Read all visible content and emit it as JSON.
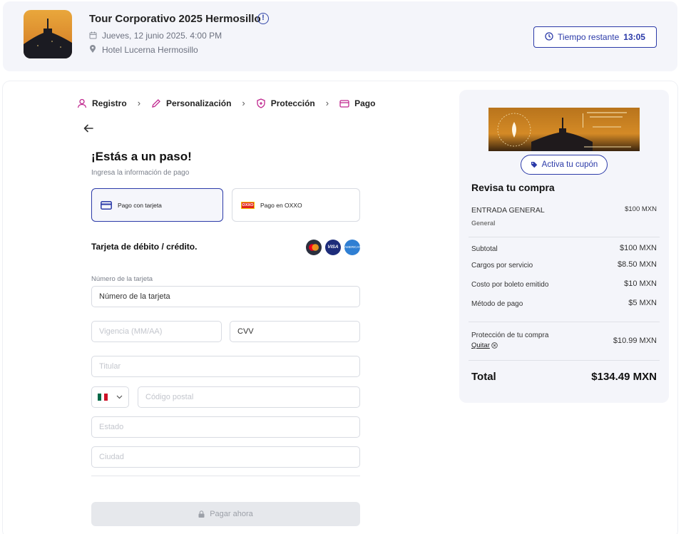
{
  "event": {
    "title": "Tour Corporativo 2025 Hermosillo",
    "date": "Jueves, 12 junio 2025. 4:00 PM",
    "venue": "Hotel Lucerna Hermosillo",
    "timer_label": "Tiempo restante",
    "timer_value": "13:05"
  },
  "steps": [
    {
      "label": "Registro",
      "icon": "user-icon"
    },
    {
      "label": "Personalización",
      "icon": "pencil-icon"
    },
    {
      "label": "Protección",
      "icon": "shield-plus-icon"
    },
    {
      "label": "Pago",
      "icon": "credit-card-icon"
    }
  ],
  "payment": {
    "heading": "¡Estás a un paso!",
    "subheading": "Ingresa la información de pago",
    "options": {
      "card": "Pago con tarjeta",
      "oxxo": "Pago en OXXO",
      "oxxo_logo": "OXXO"
    },
    "card_section_title": "Tarjeta de débito / crédito.",
    "brands": {
      "visa": "VISA",
      "amex": "AMERICAN EXPRESS"
    },
    "fields": {
      "number_label": "Número de la tarjeta",
      "number_value": "Número de la tarjeta",
      "expiry_placeholder": "Vigencia (MM/AA)",
      "cvv_value": "CVV",
      "holder_placeholder": "Titular",
      "zip_placeholder": "Código postal",
      "state_placeholder": "Estado",
      "city_placeholder": "Ciudad"
    },
    "pay_button": "Pagar ahora"
  },
  "summary": {
    "coupon_button": "Activa tu cupón",
    "title": "Revisa tu compra",
    "ticket_name": "ENTRADA GENERAL",
    "ticket_type": "General",
    "ticket_price": "$100 MXN",
    "rows": [
      {
        "label": "Subtotal",
        "value": "$100 MXN"
      },
      {
        "label": "Cargos por servicio",
        "value": "$8.50 MXN"
      },
      {
        "label": "Costo por boleto emitido",
        "value": "$10 MXN"
      },
      {
        "label": "Método de pago",
        "value": "$5 MXN"
      }
    ],
    "protection_label": "Protección de tu compra",
    "protection_remove": "Quitar",
    "protection_value": "$10.99 MXN",
    "total_label": "Total",
    "total_value": "$134.49 MXN"
  },
  "colors": {
    "accent": "#2b3aa8",
    "panel_bg": "#f4f5fa",
    "step_icon": "#c0288f"
  }
}
